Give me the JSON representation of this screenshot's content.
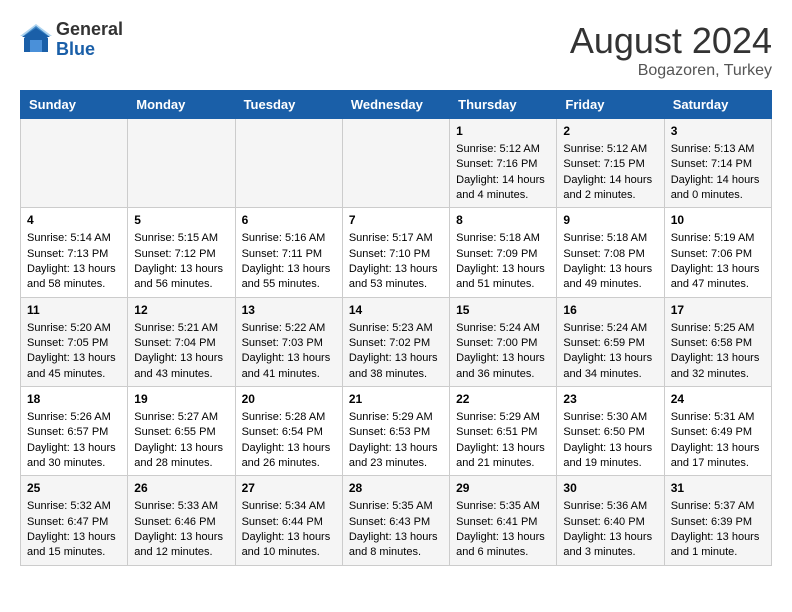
{
  "header": {
    "logo": {
      "general": "General",
      "blue": "Blue"
    },
    "title": "August 2024",
    "subtitle": "Bogazoren, Turkey"
  },
  "calendar": {
    "days_of_week": [
      "Sunday",
      "Monday",
      "Tuesday",
      "Wednesday",
      "Thursday",
      "Friday",
      "Saturday"
    ],
    "weeks": [
      [
        {
          "day": "",
          "info": ""
        },
        {
          "day": "",
          "info": ""
        },
        {
          "day": "",
          "info": ""
        },
        {
          "day": "",
          "info": ""
        },
        {
          "day": "1",
          "info": "Sunrise: 5:12 AM\nSunset: 7:16 PM\nDaylight: 14 hours\nand 4 minutes."
        },
        {
          "day": "2",
          "info": "Sunrise: 5:12 AM\nSunset: 7:15 PM\nDaylight: 14 hours\nand 2 minutes."
        },
        {
          "day": "3",
          "info": "Sunrise: 5:13 AM\nSunset: 7:14 PM\nDaylight: 14 hours\nand 0 minutes."
        }
      ],
      [
        {
          "day": "4",
          "info": "Sunrise: 5:14 AM\nSunset: 7:13 PM\nDaylight: 13 hours\nand 58 minutes."
        },
        {
          "day": "5",
          "info": "Sunrise: 5:15 AM\nSunset: 7:12 PM\nDaylight: 13 hours\nand 56 minutes."
        },
        {
          "day": "6",
          "info": "Sunrise: 5:16 AM\nSunset: 7:11 PM\nDaylight: 13 hours\nand 55 minutes."
        },
        {
          "day": "7",
          "info": "Sunrise: 5:17 AM\nSunset: 7:10 PM\nDaylight: 13 hours\nand 53 minutes."
        },
        {
          "day": "8",
          "info": "Sunrise: 5:18 AM\nSunset: 7:09 PM\nDaylight: 13 hours\nand 51 minutes."
        },
        {
          "day": "9",
          "info": "Sunrise: 5:18 AM\nSunset: 7:08 PM\nDaylight: 13 hours\nand 49 minutes."
        },
        {
          "day": "10",
          "info": "Sunrise: 5:19 AM\nSunset: 7:06 PM\nDaylight: 13 hours\nand 47 minutes."
        }
      ],
      [
        {
          "day": "11",
          "info": "Sunrise: 5:20 AM\nSunset: 7:05 PM\nDaylight: 13 hours\nand 45 minutes."
        },
        {
          "day": "12",
          "info": "Sunrise: 5:21 AM\nSunset: 7:04 PM\nDaylight: 13 hours\nand 43 minutes."
        },
        {
          "day": "13",
          "info": "Sunrise: 5:22 AM\nSunset: 7:03 PM\nDaylight: 13 hours\nand 41 minutes."
        },
        {
          "day": "14",
          "info": "Sunrise: 5:23 AM\nSunset: 7:02 PM\nDaylight: 13 hours\nand 38 minutes."
        },
        {
          "day": "15",
          "info": "Sunrise: 5:24 AM\nSunset: 7:00 PM\nDaylight: 13 hours\nand 36 minutes."
        },
        {
          "day": "16",
          "info": "Sunrise: 5:24 AM\nSunset: 6:59 PM\nDaylight: 13 hours\nand 34 minutes."
        },
        {
          "day": "17",
          "info": "Sunrise: 5:25 AM\nSunset: 6:58 PM\nDaylight: 13 hours\nand 32 minutes."
        }
      ],
      [
        {
          "day": "18",
          "info": "Sunrise: 5:26 AM\nSunset: 6:57 PM\nDaylight: 13 hours\nand 30 minutes."
        },
        {
          "day": "19",
          "info": "Sunrise: 5:27 AM\nSunset: 6:55 PM\nDaylight: 13 hours\nand 28 minutes."
        },
        {
          "day": "20",
          "info": "Sunrise: 5:28 AM\nSunset: 6:54 PM\nDaylight: 13 hours\nand 26 minutes."
        },
        {
          "day": "21",
          "info": "Sunrise: 5:29 AM\nSunset: 6:53 PM\nDaylight: 13 hours\nand 23 minutes."
        },
        {
          "day": "22",
          "info": "Sunrise: 5:29 AM\nSunset: 6:51 PM\nDaylight: 13 hours\nand 21 minutes."
        },
        {
          "day": "23",
          "info": "Sunrise: 5:30 AM\nSunset: 6:50 PM\nDaylight: 13 hours\nand 19 minutes."
        },
        {
          "day": "24",
          "info": "Sunrise: 5:31 AM\nSunset: 6:49 PM\nDaylight: 13 hours\nand 17 minutes."
        }
      ],
      [
        {
          "day": "25",
          "info": "Sunrise: 5:32 AM\nSunset: 6:47 PM\nDaylight: 13 hours\nand 15 minutes."
        },
        {
          "day": "26",
          "info": "Sunrise: 5:33 AM\nSunset: 6:46 PM\nDaylight: 13 hours\nand 12 minutes."
        },
        {
          "day": "27",
          "info": "Sunrise: 5:34 AM\nSunset: 6:44 PM\nDaylight: 13 hours\nand 10 minutes."
        },
        {
          "day": "28",
          "info": "Sunrise: 5:35 AM\nSunset: 6:43 PM\nDaylight: 13 hours\nand 8 minutes."
        },
        {
          "day": "29",
          "info": "Sunrise: 5:35 AM\nSunset: 6:41 PM\nDaylight: 13 hours\nand 6 minutes."
        },
        {
          "day": "30",
          "info": "Sunrise: 5:36 AM\nSunset: 6:40 PM\nDaylight: 13 hours\nand 3 minutes."
        },
        {
          "day": "31",
          "info": "Sunrise: 5:37 AM\nSunset: 6:39 PM\nDaylight: 13 hours\nand 1 minute."
        }
      ]
    ]
  }
}
